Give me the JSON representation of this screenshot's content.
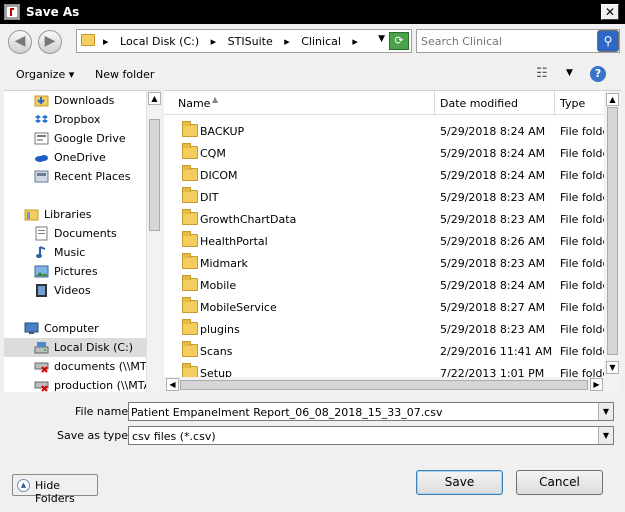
{
  "window": {
    "title": "Save As"
  },
  "address": {
    "crumbs": [
      "Local Disk (C:)",
      "STISuite",
      "Clinical"
    ]
  },
  "search": {
    "placeholder": "Search Clinical"
  },
  "toolbar": {
    "organize": "Organize ▾",
    "new_folder": "New folder"
  },
  "sidebar": {
    "favorites": [
      {
        "label": "Downloads",
        "icon": "downloads-folder-icon"
      },
      {
        "label": "Dropbox",
        "icon": "dropbox-icon"
      },
      {
        "label": "Google Drive",
        "icon": "google-drive-icon"
      },
      {
        "label": "OneDrive",
        "icon": "onedrive-icon"
      },
      {
        "label": "Recent Places",
        "icon": "recent-places-icon"
      }
    ],
    "libraries": {
      "label": "Libraries",
      "items": [
        {
          "label": "Documents",
          "icon": "documents-icon"
        },
        {
          "label": "Music",
          "icon": "music-icon"
        },
        {
          "label": "Pictures",
          "icon": "pictures-icon"
        },
        {
          "label": "Videos",
          "icon": "videos-icon"
        }
      ]
    },
    "computer": {
      "label": "Computer",
      "items": [
        {
          "label": "Local Disk (C:)",
          "icon": "drive-icon",
          "selected": true
        },
        {
          "label": "documents (\\\\MTAM",
          "icon": "network-drive-disconnected-icon"
        },
        {
          "label": "production (\\\\MTAM",
          "icon": "network-drive-disconnected-icon"
        }
      ]
    }
  },
  "columns": {
    "name": "Name",
    "date": "Date modified",
    "type": "Type"
  },
  "files": [
    {
      "name": "BACKUP",
      "date": "5/29/2018 8:24 AM",
      "type": "File folder"
    },
    {
      "name": "CQM",
      "date": "5/29/2018 8:24 AM",
      "type": "File folder"
    },
    {
      "name": "DICOM",
      "date": "5/29/2018 8:24 AM",
      "type": "File folder"
    },
    {
      "name": "DIT",
      "date": "5/29/2018 8:23 AM",
      "type": "File folder"
    },
    {
      "name": "GrowthChartData",
      "date": "5/29/2018 8:23 AM",
      "type": "File folder"
    },
    {
      "name": "HealthPortal",
      "date": "5/29/2018 8:26 AM",
      "type": "File folder"
    },
    {
      "name": "Midmark",
      "date": "5/29/2018 8:23 AM",
      "type": "File folder"
    },
    {
      "name": "Mobile",
      "date": "5/29/2018 8:24 AM",
      "type": "File folder"
    },
    {
      "name": "MobileService",
      "date": "5/29/2018 8:27 AM",
      "type": "File folder"
    },
    {
      "name": "plugins",
      "date": "5/29/2018 8:23 AM",
      "type": "File folder"
    },
    {
      "name": "Scans",
      "date": "2/29/2016 11:41 AM",
      "type": "File folder"
    },
    {
      "name": "Setup",
      "date": "7/22/2013 1:01 PM",
      "type": "File folder"
    }
  ],
  "form": {
    "filename_label": "File name:",
    "filename_value": "Patient Empanelment Report_06_08_2018_15_33_07.csv",
    "savetype_label": "Save as type:",
    "savetype_value": "csv files (*.csv)"
  },
  "buttons": {
    "hide_folders": "Hide Folders",
    "save": "Save",
    "cancel": "Cancel"
  },
  "colors": {
    "selection": "#dcdcdc",
    "folder": "#f3cd5e",
    "accent": "#2f67c4"
  }
}
